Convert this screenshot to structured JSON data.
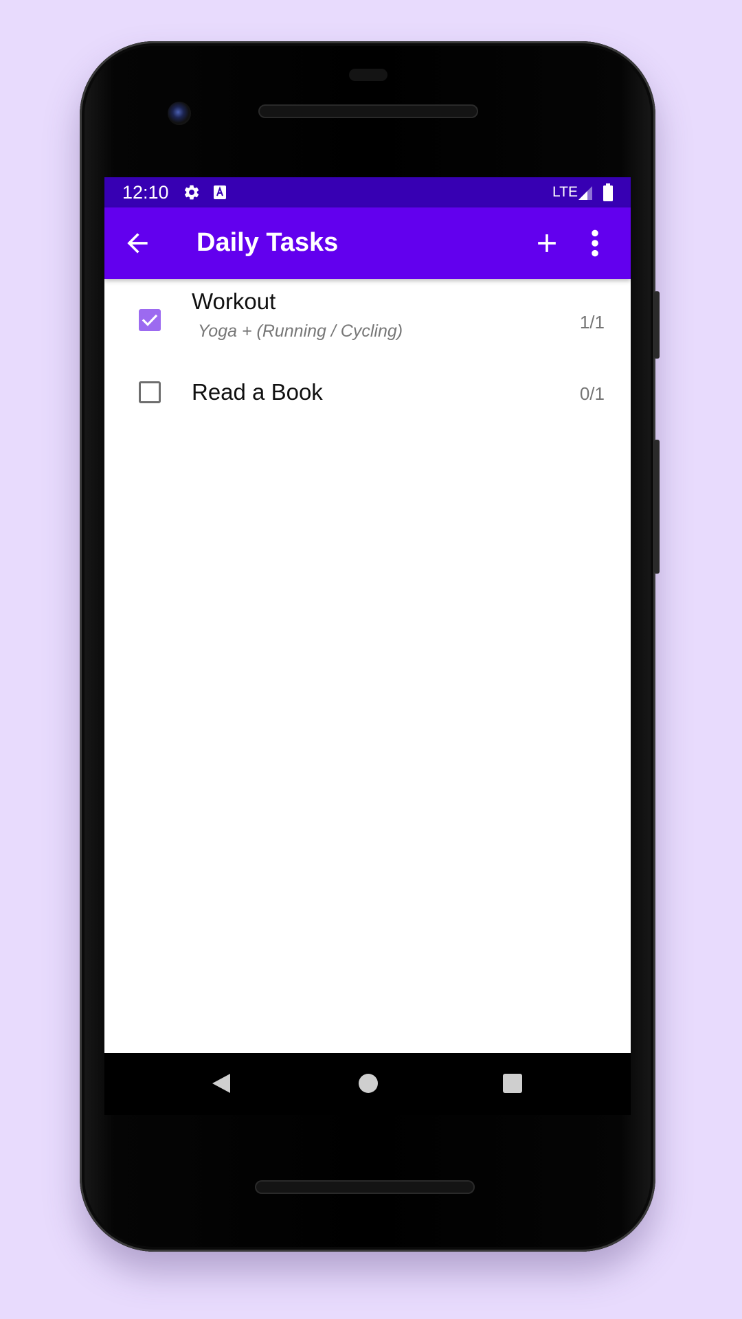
{
  "status_bar": {
    "time": "12:10",
    "icons": [
      "gear-icon",
      "keyboard-a-icon"
    ],
    "network": "LTE",
    "signal_icon": "signal-icon",
    "battery_icon": "battery-icon",
    "color": "#3700B3"
  },
  "app_bar": {
    "title": "Daily Tasks",
    "back_icon": "arrow-left-icon",
    "add_icon": "plus-icon",
    "menu_icon": "more-vert-icon",
    "color": "#6200EE"
  },
  "tasks": [
    {
      "title": "Workout",
      "subtitle": "Yoga + (Running / Cycling)",
      "count": "1/1",
      "checked": true
    },
    {
      "title": "Read a Book",
      "count": "0/1",
      "checked": false
    }
  ],
  "nav_bar": {
    "back_icon": "nav-back-icon",
    "home_icon": "nav-home-icon",
    "recents_icon": "nav-recents-icon"
  },
  "colors": {
    "background": "#E8DBFD",
    "checkbox_checked": "#9C6AF0"
  }
}
